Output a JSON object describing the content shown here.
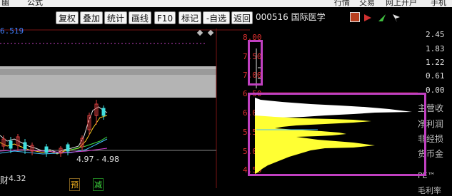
{
  "topbar": {
    "left_labels": [
      "幽",
      "公式"
    ],
    "right_labels": [
      "行情",
      "交易",
      "网上开户",
      "手机"
    ]
  },
  "toolbar": {
    "buttons": [
      "复权",
      "叠加",
      "统计",
      "画线",
      "F10",
      "标记",
      "-自选",
      "返回"
    ]
  },
  "stock": {
    "code_name": "000516 国际医学",
    "left_value_label": "6.519",
    "range_label": "4.97 - 4.98",
    "low_label": "4.32",
    "left_marker": "财",
    "marker_yu": "预",
    "marker_jian": "减"
  },
  "price_axis": {
    "labels": [
      "8.00",
      "7.50",
      "7.00",
      "6.50",
      "6.00",
      "5.50",
      "5.00",
      "4.50"
    ]
  },
  "right_axis": {
    "labels": [
      "2.45",
      "1.83",
      "1.22",
      "0.61",
      "0.00"
    ]
  },
  "financial_labels": [
    "主营收",
    "净利润",
    "非经损",
    "货币金",
    "PE™",
    "毛利率"
  ],
  "colors": {
    "highlight": "#c040c0",
    "price_axis": "#e03030",
    "chip_yellow": "#ffff33",
    "chip_white": "#ffffff"
  }
}
